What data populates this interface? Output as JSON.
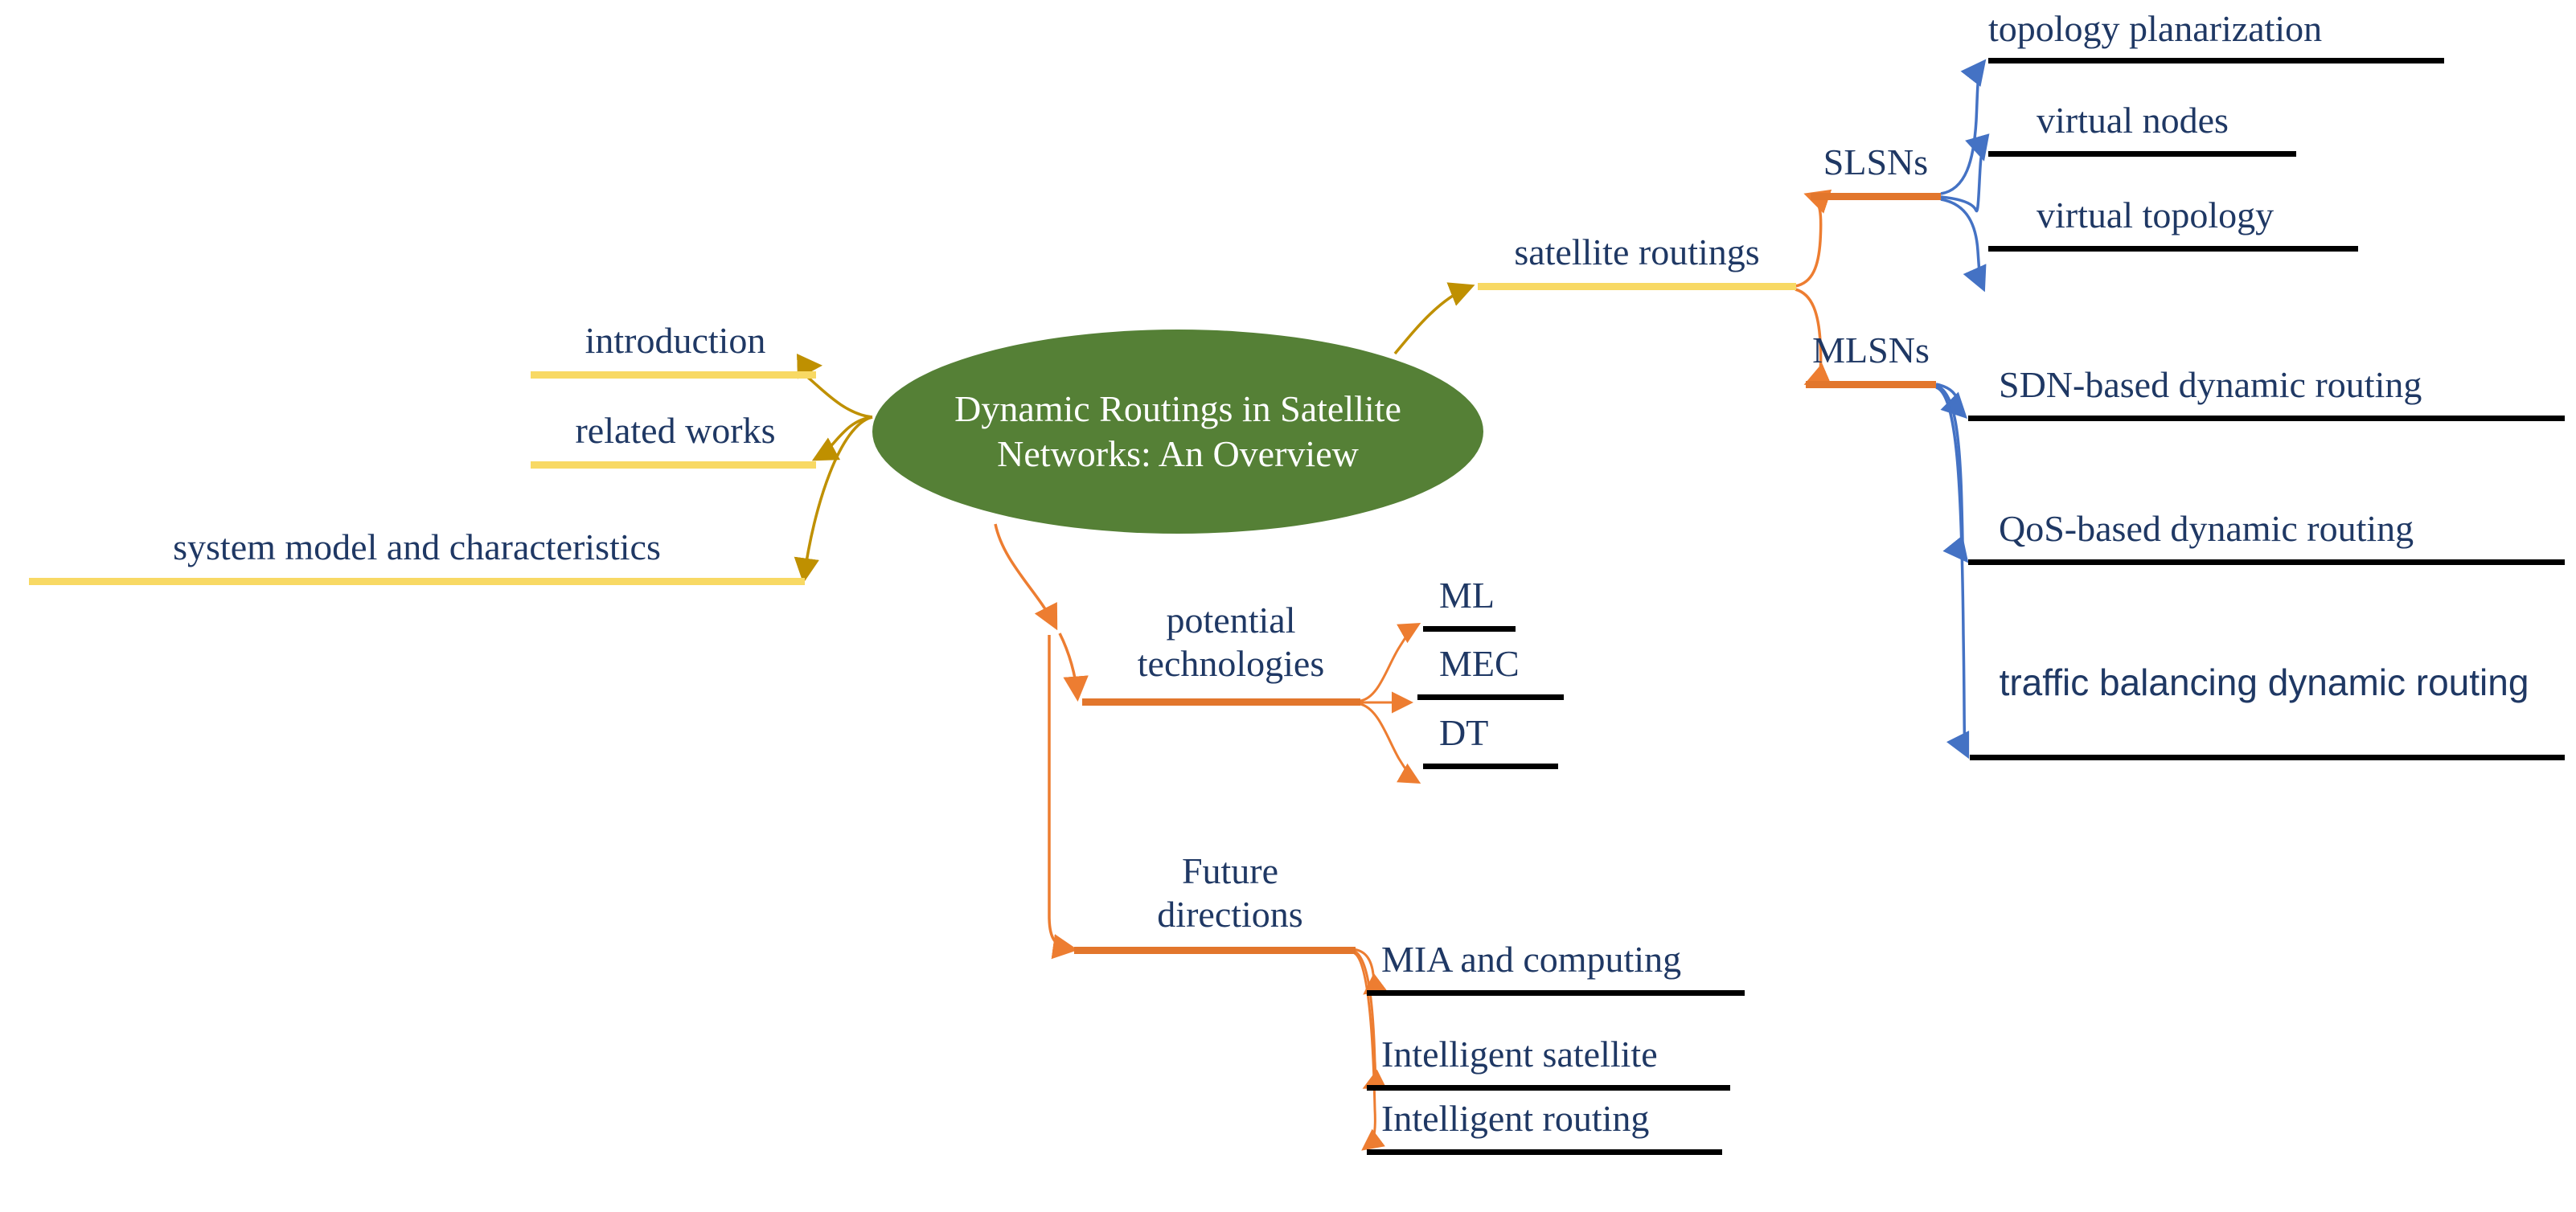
{
  "diagram": {
    "title": "Dynamic Routings in Satellite Networks: An Overview",
    "type": "mind-map",
    "colors": {
      "root_fill": "#558036",
      "root_text": "#FFFFFF",
      "node_text": "#1F3864",
      "level1_left": "#F8D964",
      "level1_right": "#F8D964",
      "level2_orange": "#E2762C",
      "level3_black": "#000000",
      "connector_yellow": "#BF9000",
      "connector_orange": "#ED7D31",
      "connector_blue": "#4472C4",
      "background": "#FFFFFF"
    }
  },
  "root": {
    "label": "Dynamic Routings in Satellite Networks: An Overview"
  },
  "branches": {
    "left": [
      {
        "label": "introduction"
      },
      {
        "label": "related works"
      },
      {
        "label": "system model and characteristics"
      }
    ],
    "satellite_routings": {
      "label": "satellite routings",
      "children": [
        {
          "label": "SLSNs",
          "children": [
            {
              "label": "topology planarization"
            },
            {
              "label": "virtual nodes"
            },
            {
              "label": "virtual topology"
            }
          ]
        },
        {
          "label": "MLSNs",
          "children": [
            {
              "label": "SDN-based dynamic routing"
            },
            {
              "label": "QoS-based dynamic routing"
            },
            {
              "label": "traffic balancing dynamic routing"
            }
          ]
        }
      ]
    },
    "potential_technologies": {
      "label": "potential technologies",
      "line1": "potential",
      "line2": "technologies",
      "children": [
        {
          "label": "ML"
        },
        {
          "label": "MEC"
        },
        {
          "label": "DT"
        }
      ]
    },
    "future_directions": {
      "label": "Future directions",
      "line1": "Future",
      "line2": "directions",
      "children": [
        {
          "label": "MIA and computing"
        },
        {
          "label": "Intelligent satellite"
        },
        {
          "label": "Intelligent routing"
        }
      ]
    }
  }
}
